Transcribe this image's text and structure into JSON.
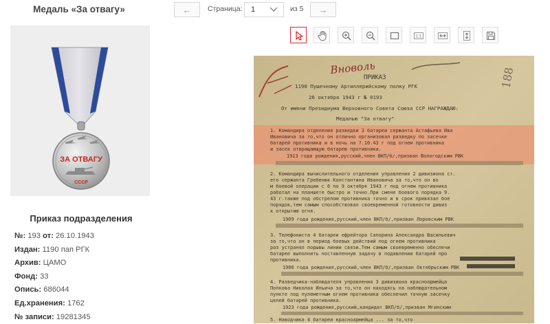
{
  "award": {
    "title": "Медаль «За отвагу»"
  },
  "order": {
    "heading": "Приказ подразделения",
    "fields": [
      {
        "label": "№:",
        "value": "193",
        "label2": "от:",
        "value2": "26.10.1943"
      },
      {
        "label": "Издан:",
        "value": "1190 пап РГК"
      },
      {
        "label": "Архив:",
        "value": "ЦАМО"
      },
      {
        "label": "Фонд:",
        "value": "33"
      },
      {
        "label": "Опись:",
        "value": "686044"
      },
      {
        "label": "Ед.хранения:",
        "value": "1762"
      },
      {
        "label": "№ записи:",
        "value": "19281345"
      }
    ]
  },
  "pager": {
    "prev": "←",
    "next": "→",
    "page_label": "Страница:",
    "current": "1",
    "of_label": "из 5"
  },
  "toolbar": {
    "tools": [
      {
        "name": "cursor",
        "icon": "cursor-icon",
        "active": true
      },
      {
        "name": "pan",
        "icon": "hand-icon"
      },
      {
        "name": "zoom-in",
        "icon": "zoom-in-icon"
      },
      {
        "name": "zoom-out",
        "icon": "zoom-out-icon"
      },
      {
        "name": "select",
        "icon": "rectangle-select-icon"
      },
      {
        "name": "actual-size",
        "icon": "actual-size-icon"
      },
      {
        "name": "fit-width",
        "icon": "fit-width-icon"
      },
      {
        "name": "fit-height",
        "icon": "fit-height-icon"
      },
      {
        "name": "save",
        "icon": "save-icon"
      }
    ]
  },
  "colors": {
    "accent": "#e0262b",
    "paper": "#cfbf95",
    "highlight": "#f08a6a",
    "panel": "#eeeeee"
  },
  "document": {
    "header_word": "ПРИКАЗ",
    "unit_line": "1190 Пушечному Артиллерийскому полку РГК",
    "date_line": "26 октября 1943 г    № 0193",
    "decree_line": "От имени Президиума Верховного Совета Союза ССР НАГРАЖДАЮ:",
    "medal_line": "Медалью \"За отвагу\"",
    "handwritten": "Вноволь",
    "margin_number": "188",
    "medal_ribbon_text": "ЗА ОТВАГУ",
    "medal_bottom_text": "СССР",
    "entry_1": [
      "1. Командира отделения разведки 3 батареи сержанта Астафьева Ива",
      "Ивановича за то,что он отлично организовал разведку по засечке",
      "батарей противника и в ночь на 7.10.43 г под огнем противника",
      "и засек отвращающую батарею противника.",
      "1913 года рождения,русский,член ВКП/б/,призван Вологодским РВК"
    ],
    "entry_2": [
      "2. Командира вычислительного отделения управления 2 дивизиона ст.",
      "его сержанта Гребенюк Константина Ивановича за то,что он во",
      "м боевой операции с 6 по 9 октября 1943 г под огнем противника",
      "работал на планшете быстро и точно.При смене боевого порядка 9.",
      "43 г.также под обстрелом противника точно и в срок привязал бое",
      "порядок,тем самым способствовал своевременной готовности дивиз",
      "к открытию огня.",
      "1909 года рождения,русский,член ВКП/б/,призван Лоровским РВК"
    ],
    "entry_3": [
      "3. Телефониста 4 батареи ефрейтора Сапорина Александра Васильевич",
      "за то,что он в период боевых действий под огнем противника",
      "раз устранял порывы линии связи.Тем самым своевременно обеспечи",
      "батарее выполнить поставленную задачу в подавлении батарей про",
      "противника.",
      "1906 года рождения,русский,член ВКП/б/,призван Октябрьским РВК"
    ],
    "entry_4": [
      "4. Разведчика-наблюдателя управления 3 дивизиона красноармейца",
      "Попкова Николая Ильича за то,что он находясь на наблюдательном",
      "пункте под пулеметным огнем противника обеспечил точную засечку",
      "целей батарей противника.",
      "1923 года рождения,русский,кандидат ВКП/б/,призван Мгинским"
    ],
    "entry_5": [
      "5. Наводчика 4 батареи красноармейца ... за то,что"
    ]
  }
}
